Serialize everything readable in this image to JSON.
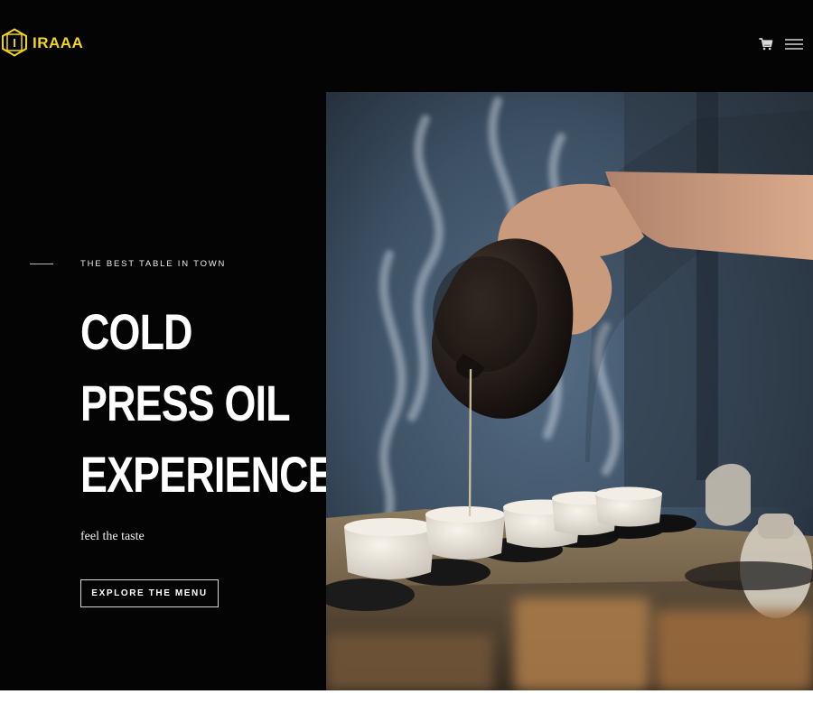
{
  "header": {
    "logo_text": "IRAAA",
    "logo_icon_letter": "I",
    "logo_icon": "hexagon-logo-icon",
    "cart_icon": "cart-icon",
    "menu_icon": "hamburger-menu-icon"
  },
  "hero": {
    "eyebrow": "THE BEST TABLE IN TOWN",
    "title_lines": [
      "COLD",
      "PRESS OIL",
      "EXPERIENCE"
    ],
    "tagline": "feel the taste",
    "cta_label": "EXPLORE THE MENU",
    "photo_subject": "tea-pouring-photo"
  },
  "colors": {
    "background": "#040404",
    "accent_logo": "#F3D51A",
    "text": "#FFFFFF",
    "button_border": "#D8D8D8",
    "page_bottom": "#FFFFFF"
  }
}
